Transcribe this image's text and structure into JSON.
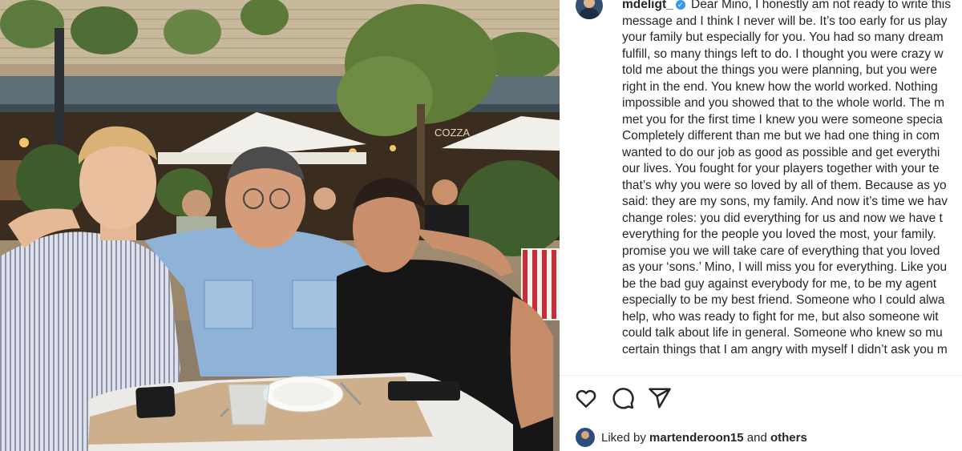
{
  "post": {
    "username": "mdeligt_",
    "verified_badge": "✓",
    "caption_lines": [
      "Dear Mino, I honestly am not ready to write this",
      "message and I think I never will be. It’s too early for us play",
      "your family but especially for you. You had so many dream",
      "fulfill, so many things left to do. I thought you were crazy w",
      "told me about the things you were planning, but you were",
      "right in the end. You knew how the world worked. Nothing",
      "impossible and you showed that to the whole world. The m",
      "met you for the first time I knew you were someone specia",
      "Completely different than me but we had one thing in com",
      "wanted to do our job as good as possible and get everythi",
      "our lives. You fought for your players together with your te",
      "that’s why you were so loved by all of them. Because as yo",
      "said: they are my sons, my family. And now it’s time we hav",
      "change roles: you did everything for us and now we have t",
      "everything for the people you loved the most, your family.",
      "promise you we will take care of everything that you loved",
      "as your ‘sons.’ Mino, I will miss you for everything. Like you",
      "be the bad guy against everybody for me, to be my agent",
      "especially to be my best friend. Someone who I could alwa",
      "help, who was ready to fight for me, but also someone wit",
      "could talk about life in general. Someone who knew so mu",
      "certain things that I am angry with myself I didn’t ask you m"
    ]
  },
  "photo": {
    "sign_text": "COZZA"
  },
  "actions": {
    "like_icon": "heart-icon",
    "comment_icon": "comment-icon",
    "share_icon": "share-icon"
  },
  "likes": {
    "prefix": "Liked by",
    "user": "martenderoon15",
    "conjunction": "and",
    "others": "others"
  }
}
